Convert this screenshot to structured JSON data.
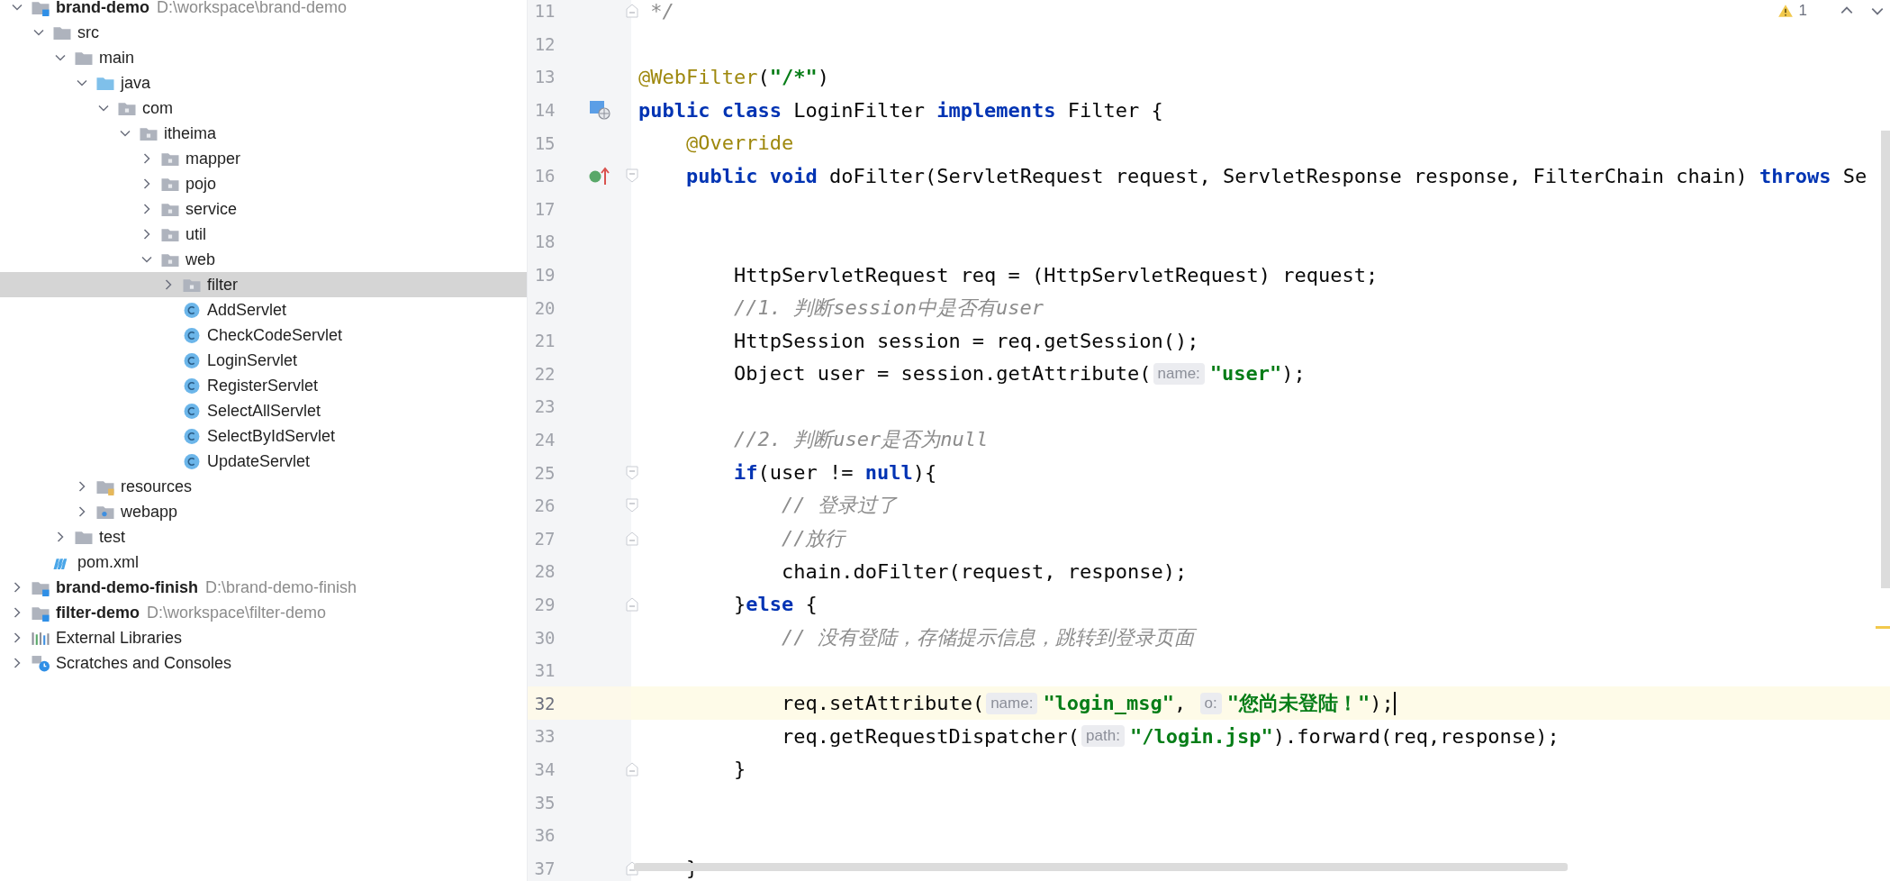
{
  "project_tree": {
    "items": [
      {
        "label": "brand-demo",
        "path": "D:\\workspace\\brand-demo",
        "kind": "project",
        "expanded": true,
        "selected": false,
        "children": [
          {
            "label": "src",
            "kind": "folder",
            "expanded": true,
            "selected": false,
            "children": [
              {
                "label": "main",
                "kind": "folder",
                "expanded": true,
                "selected": false,
                "children": [
                  {
                    "label": "java",
                    "kind": "source",
                    "expanded": true,
                    "selected": false,
                    "children": [
                      {
                        "label": "com",
                        "kind": "package",
                        "expanded": true,
                        "selected": false,
                        "children": [
                          {
                            "label": "itheima",
                            "kind": "package",
                            "expanded": true,
                            "selected": false,
                            "children": [
                              {
                                "label": "mapper",
                                "kind": "package",
                                "expanded": false,
                                "selected": false
                              },
                              {
                                "label": "pojo",
                                "kind": "package",
                                "expanded": false,
                                "selected": false
                              },
                              {
                                "label": "service",
                                "kind": "package",
                                "expanded": false,
                                "selected": false
                              },
                              {
                                "label": "util",
                                "kind": "package",
                                "expanded": false,
                                "selected": false
                              },
                              {
                                "label": "web",
                                "kind": "package",
                                "expanded": true,
                                "selected": false,
                                "children": [
                                  {
                                    "label": "filter",
                                    "kind": "package",
                                    "expanded": false,
                                    "selected": true
                                  },
                                  {
                                    "label": "AddServlet",
                                    "kind": "class",
                                    "selected": false
                                  },
                                  {
                                    "label": "CheckCodeServlet",
                                    "kind": "class",
                                    "selected": false
                                  },
                                  {
                                    "label": "LoginServlet",
                                    "kind": "class",
                                    "selected": false
                                  },
                                  {
                                    "label": "RegisterServlet",
                                    "kind": "class",
                                    "selected": false
                                  },
                                  {
                                    "label": "SelectAllServlet",
                                    "kind": "class",
                                    "selected": false
                                  },
                                  {
                                    "label": "SelectByIdServlet",
                                    "kind": "class",
                                    "selected": false
                                  },
                                  {
                                    "label": "UpdateServlet",
                                    "kind": "class",
                                    "selected": false
                                  }
                                ]
                              }
                            ]
                          }
                        ]
                      }
                    ]
                  },
                  {
                    "label": "resources",
                    "kind": "resources",
                    "expanded": false,
                    "selected": false
                  },
                  {
                    "label": "webapp",
                    "kind": "webapp",
                    "expanded": false,
                    "selected": false
                  }
                ]
              },
              {
                "label": "test",
                "kind": "folder",
                "expanded": false,
                "selected": false
              }
            ]
          },
          {
            "label": "pom.xml",
            "kind": "maven",
            "selected": false
          }
        ]
      },
      {
        "label": "brand-demo-finish",
        "path": "D:\\brand-demo-finish",
        "kind": "project",
        "expanded": false,
        "selected": false
      },
      {
        "label": "filter-demo",
        "path": "D:\\workspace\\filter-demo",
        "kind": "project",
        "expanded": false,
        "selected": false
      },
      {
        "label": "External Libraries",
        "kind": "libraries",
        "expanded": false,
        "selected": false
      },
      {
        "label": "Scratches and Consoles",
        "kind": "scratches",
        "expanded": false,
        "selected": false
      }
    ]
  },
  "editor": {
    "problems": {
      "count": "1"
    },
    "lines": [
      {
        "number": "11",
        "markers": [
          {
            "kind": "fold-end"
          }
        ],
        "current": false,
        "tokens": [
          {
            "kind": "cmt",
            "text": " */"
          }
        ]
      },
      {
        "number": "12",
        "current": false
      },
      {
        "number": "13",
        "current": false,
        "tokens": [
          {
            "kind": "ann",
            "text": "@WebFilter"
          },
          {
            "kind": "plain",
            "text": "("
          },
          {
            "kind": "str",
            "text": "\"/*\""
          },
          {
            "kind": "plain",
            "text": ")"
          }
        ]
      },
      {
        "number": "14",
        "markers": [
          {
            "kind": "class"
          }
        ],
        "current": false,
        "tokens": [
          {
            "kind": "kw",
            "text": "public class"
          },
          {
            "kind": "plain",
            "text": " LoginFilter "
          },
          {
            "kind": "kw",
            "text": "implements"
          },
          {
            "kind": "plain",
            "text": " Filter {"
          }
        ]
      },
      {
        "number": "15",
        "current": false,
        "tokens": [
          {
            "kind": "ann",
            "text": "    @Override"
          }
        ]
      },
      {
        "number": "16",
        "markers": [
          {
            "kind": "implements"
          },
          {
            "kind": "fold-start"
          }
        ],
        "current": false,
        "tokens": [
          {
            "kind": "kw",
            "text": "    public void"
          },
          {
            "kind": "plain",
            "text": " doFilter(ServletRequest request, ServletResponse response, FilterChain chain) "
          },
          {
            "kind": "kw",
            "text": "throws"
          },
          {
            "kind": "plain",
            "text": " Se"
          }
        ]
      },
      {
        "number": "17",
        "current": false
      },
      {
        "number": "18",
        "current": false
      },
      {
        "number": "19",
        "current": false,
        "tokens": [
          {
            "kind": "plain",
            "text": "        HttpServletRequest req = (HttpServletRequest) request;"
          }
        ]
      },
      {
        "number": "20",
        "current": false,
        "tokens": [
          {
            "kind": "cmt",
            "text": "        //1. 判断session中是否有user"
          }
        ]
      },
      {
        "number": "21",
        "current": false,
        "tokens": [
          {
            "kind": "plain",
            "text": "        HttpSession session = req.getSession();"
          }
        ]
      },
      {
        "number": "22",
        "current": false,
        "tokens": [
          {
            "kind": "plain",
            "text": "        Object user = session.getAttribute("
          },
          {
            "kind": "hint",
            "text": "name:"
          },
          {
            "kind": "str",
            "text": "\"user\""
          },
          {
            "kind": "plain",
            "text": ");"
          }
        ]
      },
      {
        "number": "23",
        "current": false
      },
      {
        "number": "24",
        "current": false,
        "tokens": [
          {
            "kind": "cmt",
            "text": "        //2. 判断user是否为null"
          }
        ]
      },
      {
        "number": "25",
        "markers": [
          {
            "kind": "fold-start"
          }
        ],
        "current": false,
        "tokens": [
          {
            "kind": "kw",
            "text": "        if"
          },
          {
            "kind": "plain",
            "text": "(user != "
          },
          {
            "kind": "kw",
            "text": "null"
          },
          {
            "kind": "plain",
            "text": "){"
          }
        ]
      },
      {
        "number": "26",
        "markers": [
          {
            "kind": "fold-start"
          }
        ],
        "current": false,
        "tokens": [
          {
            "kind": "cmt",
            "text": "            // 登录过了"
          }
        ]
      },
      {
        "number": "27",
        "markers": [
          {
            "kind": "fold-end"
          }
        ],
        "current": false,
        "tokens": [
          {
            "kind": "cmt",
            "text": "            //放行"
          }
        ]
      },
      {
        "number": "28",
        "current": false,
        "tokens": [
          {
            "kind": "plain",
            "text": "            chain.doFilter(request, response);"
          }
        ]
      },
      {
        "number": "29",
        "markers": [
          {
            "kind": "fold-end"
          }
        ],
        "current": false,
        "tokens": [
          {
            "kind": "plain",
            "text": "        }"
          },
          {
            "kind": "kw",
            "text": "else"
          },
          {
            "kind": "plain",
            "text": " {"
          }
        ]
      },
      {
        "number": "30",
        "current": false,
        "tokens": [
          {
            "kind": "cmt",
            "text": "            // 没有登陆，存储提示信息，跳转到登录页面"
          }
        ]
      },
      {
        "number": "31",
        "current": false
      },
      {
        "number": "32",
        "current": true,
        "tokens": [
          {
            "kind": "plain",
            "text": "            req.setAttribute("
          },
          {
            "kind": "hint",
            "text": "name:"
          },
          {
            "kind": "str",
            "text": "\"login_msg\""
          },
          {
            "kind": "plain",
            "text": ", "
          },
          {
            "kind": "hint",
            "text": "o:"
          },
          {
            "kind": "str",
            "text": "\"您尚未登陆！\""
          },
          {
            "kind": "plain",
            "text": ");"
          }
        ]
      },
      {
        "number": "33",
        "current": false,
        "tokens": [
          {
            "kind": "plain",
            "text": "            req.getRequestDispatcher("
          },
          {
            "kind": "hint",
            "text": "path:"
          },
          {
            "kind": "str",
            "text": "\"/login.jsp\""
          },
          {
            "kind": "plain",
            "text": ").forward(req,response);"
          }
        ]
      },
      {
        "number": "34",
        "markers": [
          {
            "kind": "fold-end"
          }
        ],
        "current": false,
        "tokens": [
          {
            "kind": "plain",
            "text": "        }"
          }
        ]
      },
      {
        "number": "35",
        "current": false
      },
      {
        "number": "36",
        "current": false
      },
      {
        "number": "37",
        "markers": [
          {
            "kind": "fold-end"
          }
        ],
        "current": false,
        "tokens": [
          {
            "kind": "plain",
            "text": "    }"
          }
        ]
      }
    ]
  }
}
